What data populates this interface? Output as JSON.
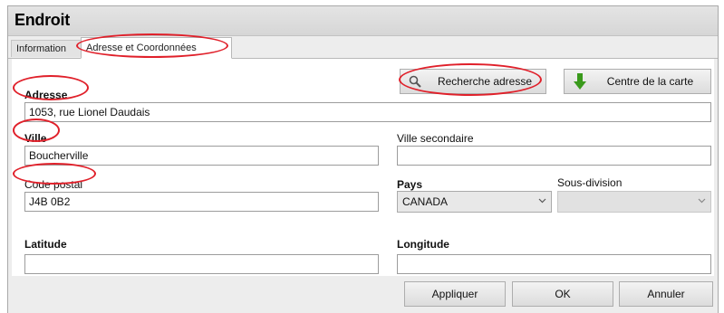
{
  "window": {
    "title": "Endroit"
  },
  "tabs": [
    {
      "label": "Information"
    },
    {
      "label": "Adresse et Coordonnées"
    }
  ],
  "toolbar": {
    "search_address_label": "Recherche adresse",
    "map_center_label": "Centre de la carte"
  },
  "form": {
    "adresse": {
      "label": "Adresse",
      "value": "1053, rue Lionel Daudais"
    },
    "ville": {
      "label": "Ville",
      "value": "Boucherville"
    },
    "ville_secondaire": {
      "label": "Ville secondaire",
      "value": ""
    },
    "code_postal": {
      "label": "Code postal",
      "value": "J4B 0B2"
    },
    "pays": {
      "label": "Pays",
      "value": "CANADA"
    },
    "sous_division": {
      "label": "Sous-division",
      "value": ""
    },
    "latitude": {
      "label": "Latitude",
      "value": ""
    },
    "longitude": {
      "label": "Longitude",
      "value": ""
    }
  },
  "footer": {
    "apply_label": "Appliquer",
    "ok_label": "OK",
    "cancel_label": "Annuler"
  },
  "colors": {
    "annotation": "#e0202a",
    "arrow_icon": "#3a9a1c"
  },
  "icons": {
    "search": "magnifier-icon",
    "map_center": "down-arrow-icon",
    "dropdown": "chevron-down-icon"
  }
}
